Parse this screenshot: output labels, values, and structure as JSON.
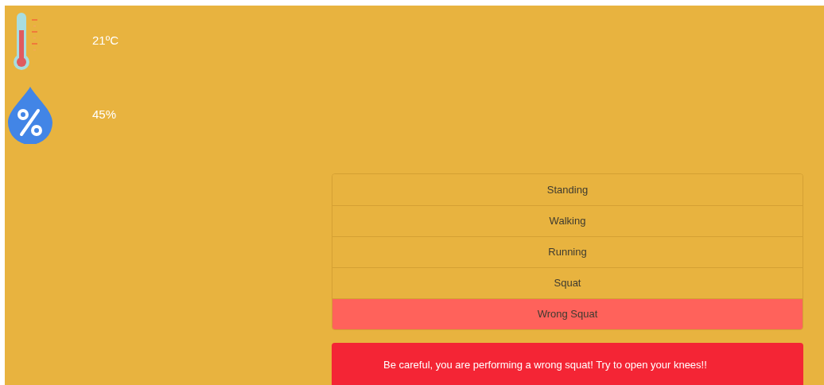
{
  "readings": [
    {
      "kind": "temperature",
      "value": "21ºC"
    },
    {
      "kind": "humidity",
      "value": "45%"
    }
  ],
  "activities": [
    {
      "label": "Standing",
      "selected": false
    },
    {
      "label": "Walking",
      "selected": false
    },
    {
      "label": "Running",
      "selected": false
    },
    {
      "label": "Squat",
      "selected": false
    },
    {
      "label": "Wrong Squat",
      "selected": true
    }
  ],
  "alert": "Be careful, you are performing a wrong squat! Try to open your knees!!"
}
